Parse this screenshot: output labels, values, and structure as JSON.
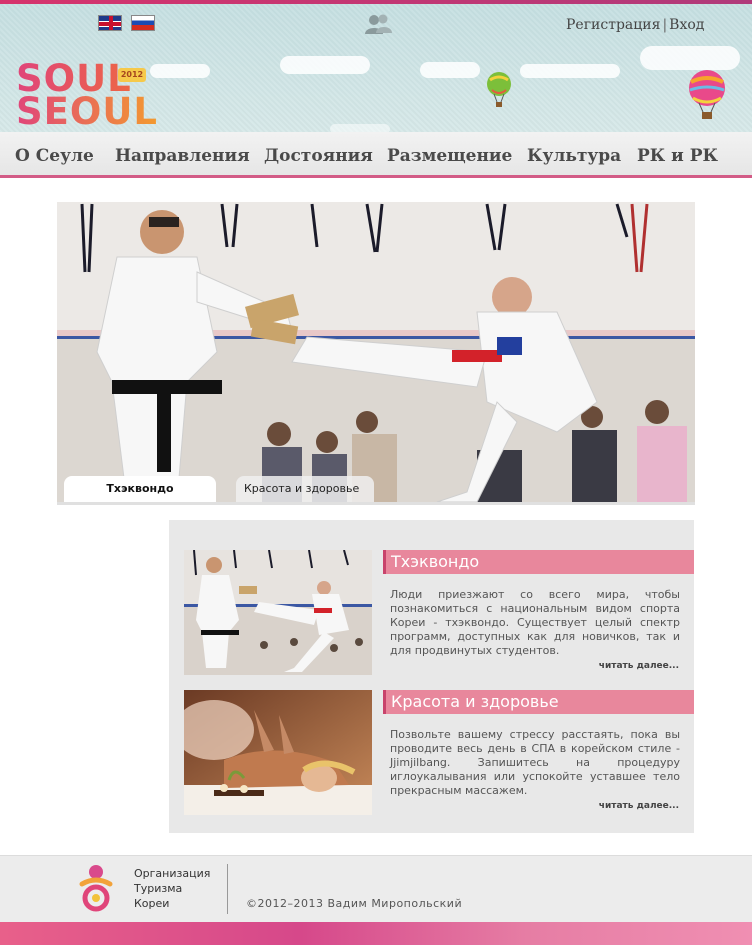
{
  "header": {
    "languages": [
      {
        "name": "English",
        "icon": "uk-flag-icon"
      },
      {
        "name": "Русский",
        "icon": "ru-flag-icon"
      }
    ],
    "users_icon": "users-icon",
    "register_label": "Регистрация",
    "separator": "|",
    "login_label": "Вход",
    "logo": {
      "line1": "SOUL",
      "line2": "SEOUL",
      "badge": "2012"
    }
  },
  "nav": {
    "items": [
      {
        "label": "О Сеуле"
      },
      {
        "label": "Направления"
      },
      {
        "label": "Достояния"
      },
      {
        "label": "Размещение"
      },
      {
        "label": "Культура"
      },
      {
        "label": "РК и РК"
      }
    ]
  },
  "slider": {
    "tabs": [
      {
        "label": "Тхэквондо",
        "active": true
      },
      {
        "label": "Красота и здоровье",
        "active": false
      }
    ]
  },
  "articles": [
    {
      "title": "Тхэквондо",
      "text": "Люди приезжают со всего мира, чтобы познакомиться с национальным видом спорта Кореи - тхэквондо. Существует целый спектр программ, доступных как для новичков, так и для продвинутых студентов.",
      "more": "читать далее..."
    },
    {
      "title": "Красота и здоровье",
      "text": "Позвольте вашему стрессу расстаять, пока вы проводите весь день в СПА в корейском стиле - Jjimjilbang. Запишитесь на процедуру иглоукалывания или успокойте уставшее тело прекрасным массажем.",
      "more": "читать далее..."
    }
  ],
  "footer": {
    "org_lines": [
      "Организация",
      "Туризма",
      "Кореи"
    ],
    "copyright": "©2012–2013 Вадим Миропольский"
  },
  "colors": {
    "accent_pink": "#e8879c",
    "nav_underline": "#d25b86",
    "header_sky": "#cfe3e4"
  }
}
